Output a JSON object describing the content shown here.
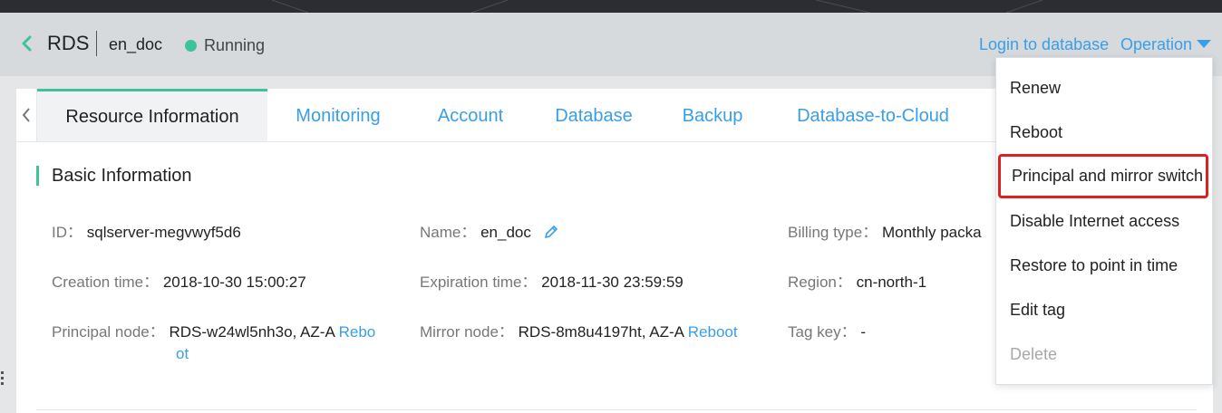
{
  "header": {
    "back_icon": "chevron-left-icon",
    "title": "RDS",
    "instance_name": "en_doc",
    "status": "Running",
    "status_color": "#3ec29b",
    "login_link": "Login to database",
    "operation_label": "Operation"
  },
  "tabs": [
    {
      "label": "Resource Information",
      "active": true
    },
    {
      "label": "Monitoring"
    },
    {
      "label": "Account"
    },
    {
      "label": "Database"
    },
    {
      "label": "Backup"
    },
    {
      "label": "Database-to-Cloud"
    }
  ],
  "section": {
    "title": "Basic Information"
  },
  "fields": {
    "id": {
      "label": "ID：",
      "value": "sqlserver-megvwyf5d6"
    },
    "name": {
      "label": "Name：",
      "value": "en_doc",
      "edit_icon": "pencil-icon"
    },
    "billing_type": {
      "label": "Billing type：",
      "value": "Monthly packa"
    },
    "creation_time": {
      "label": "Creation time：",
      "value": "2018-10-30 15:00:27"
    },
    "expiration_time": {
      "label": "Expiration time：",
      "value": "2018-11-30 23:59:59"
    },
    "region": {
      "label": "Region：",
      "value": "cn-north-1"
    },
    "principal_node": {
      "label": "Principal node：",
      "value": "RDS-w24wl5nh3o, AZ-A",
      "link_part1": "Rebo",
      "link_part2": "ot"
    },
    "mirror_node": {
      "label": "Mirror node：",
      "value": "RDS-8m8u4197ht, AZ-A",
      "link": "Reboot"
    },
    "tag_key": {
      "label": "Tag key：",
      "value": "-"
    }
  },
  "operation_menu": [
    {
      "label": "Renew"
    },
    {
      "label": "Reboot"
    },
    {
      "label": "Principal and mirror switch",
      "highlighted": true
    },
    {
      "label": "Disable Internet access"
    },
    {
      "label": "Restore to point in time"
    },
    {
      "label": "Edit tag"
    },
    {
      "label": "Delete",
      "disabled": true
    }
  ],
  "colors": {
    "accent": "#3a9ee6",
    "active_tab_border": "#3ec29b",
    "highlight_border": "#e02020"
  }
}
